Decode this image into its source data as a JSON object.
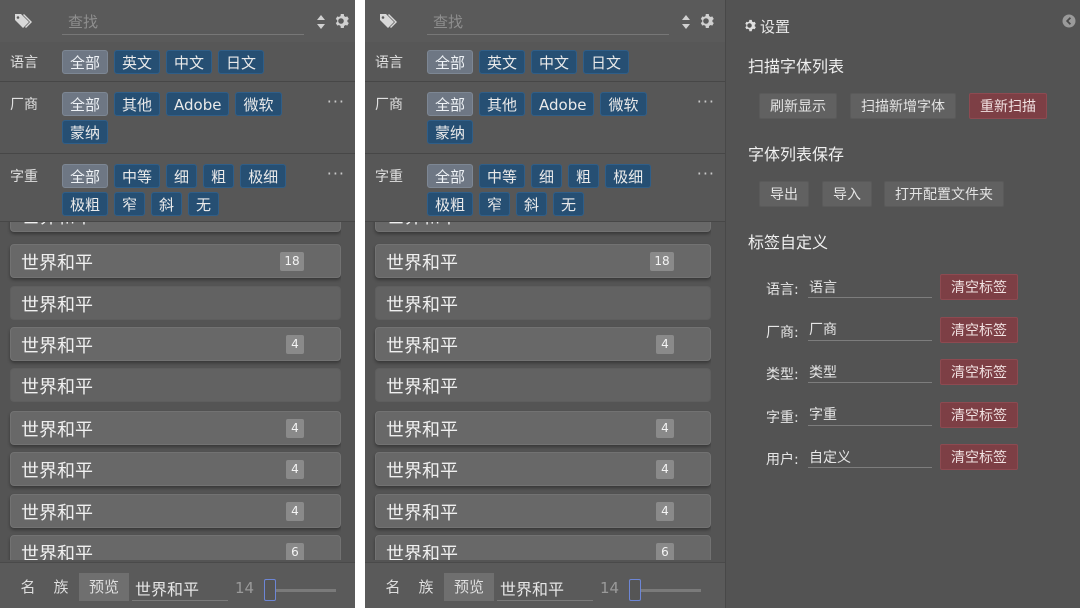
{
  "panels": [
    {
      "search": {
        "placeholder": "查找",
        "value": ""
      },
      "filters": [
        {
          "label": "语言",
          "chips": [
            "全部",
            "英文",
            "中文",
            "日文"
          ],
          "has_more": false
        },
        {
          "label": "厂商",
          "chips": [
            "全部",
            "其他",
            "Adobe",
            "微软",
            "蒙纳"
          ],
          "has_more": true
        },
        {
          "label": "字重",
          "chips": [
            "全部",
            "中等",
            "细",
            "粗",
            "极细",
            "极粗",
            "窄",
            "斜",
            "无"
          ],
          "has_more": true
        }
      ],
      "more_label": "···",
      "items": [
        {
          "name": "世界和平",
          "count": ""
        },
        {
          "name": "世界和平",
          "count": "18"
        },
        {
          "name": "世界和平",
          "count": ""
        },
        {
          "name": "世界和平",
          "count": "4"
        },
        {
          "name": "世界和平",
          "count": ""
        },
        {
          "name": "世界和平",
          "count": "4"
        },
        {
          "name": "世界和平",
          "count": "4"
        },
        {
          "name": "世界和平",
          "count": "4"
        },
        {
          "name": "世界和平",
          "count": "6"
        }
      ],
      "bottom": {
        "tabs": [
          "名",
          "族",
          "预览"
        ],
        "active_tab": "预览",
        "preview_text": "世界和平",
        "size": "14",
        "size_level": 0.0
      }
    },
    {
      "search": {
        "placeholder": "查找",
        "value": ""
      },
      "filters": [
        {
          "label": "语言",
          "chips": [
            "全部",
            "英文",
            "中文",
            "日文"
          ],
          "has_more": false
        },
        {
          "label": "厂商",
          "chips": [
            "全部",
            "其他",
            "Adobe",
            "微软",
            "蒙纳"
          ],
          "has_more": true
        },
        {
          "label": "字重",
          "chips": [
            "全部",
            "中等",
            "细",
            "粗",
            "极细",
            "极粗",
            "窄",
            "斜",
            "无"
          ],
          "has_more": true
        }
      ],
      "more_label": "···",
      "items": [
        {
          "name": "世界和平",
          "count": ""
        },
        {
          "name": "世界和平",
          "count": "18"
        },
        {
          "name": "世界和平",
          "count": ""
        },
        {
          "name": "世界和平",
          "count": "4"
        },
        {
          "name": "世界和平",
          "count": ""
        },
        {
          "name": "世界和平",
          "count": "4"
        },
        {
          "name": "世界和平",
          "count": "4"
        },
        {
          "name": "世界和平",
          "count": "4"
        },
        {
          "name": "世界和平",
          "count": "6"
        }
      ],
      "bottom": {
        "tabs": [
          "名",
          "族",
          "预览"
        ],
        "active_tab": "预览",
        "preview_text": "世界和平",
        "size": "14",
        "size_level": 0.0
      }
    }
  ],
  "settings": {
    "title": "设置",
    "scan": {
      "heading": "扫描字体列表",
      "refresh": "刷新显示",
      "scan_new": "扫描新增字体",
      "rescan": "重新扫描"
    },
    "save": {
      "heading": "字体列表保存",
      "export": "导出",
      "import": "导入",
      "open_folder": "打开配置文件夹"
    },
    "tags": {
      "heading": "标签自定义",
      "clear_label": "清空标签",
      "rows": [
        {
          "label": "语言:",
          "value": "语言"
        },
        {
          "label": "厂商:",
          "value": "厂商"
        },
        {
          "label": "类型:",
          "value": "类型"
        },
        {
          "label": "字重:",
          "value": "字重"
        },
        {
          "label": "用户:",
          "value": "自定义"
        }
      ]
    }
  },
  "colors": {
    "panel_bg": "#545454",
    "chip_blue": "#264f73",
    "chip_all": "#6e7784",
    "danger": "#7d3f45"
  }
}
